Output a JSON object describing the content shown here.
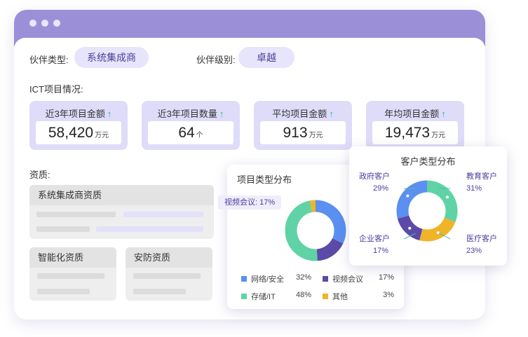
{
  "window_controls": [
    "dot",
    "dot",
    "dot"
  ],
  "partner": {
    "type_label": "伙伴类型:",
    "type_value": "系统集成商",
    "level_label": "伙伴级别:",
    "level_value": "卓越"
  },
  "ict": {
    "section_label": "ICT项目情况:",
    "cards": [
      {
        "title": "近3年项目金额",
        "value": "58,420",
        "unit": "万元",
        "icon": "arrow-up-icon"
      },
      {
        "title": "近3年项目数量",
        "value": "64",
        "unit": "个",
        "icon": "arrow-up-icon"
      },
      {
        "title": "平均项目金额",
        "value": "913",
        "unit": "万元",
        "icon": "arrow-up-icon"
      },
      {
        "title": "年均项目金额",
        "value": "19,473",
        "unit": "万元",
        "icon": "arrow-up-icon"
      }
    ]
  },
  "qualification": {
    "section_label": "资质:",
    "system_panel": "系统集成商资质",
    "smart_panel": "智能化资质",
    "security_panel": "安防资质"
  },
  "project_type_chart": {
    "tooltip": "视频会议: 17%",
    "arrow_glyph": "↑"
  },
  "chart_data": [
    {
      "type": "pie",
      "title": "项目类型分布",
      "categories": [
        "网络/安全",
        "视频会议",
        "存储/IT",
        "其他"
      ],
      "labels": [
        "32%",
        "17%",
        "48%",
        "3%"
      ],
      "values": [
        32,
        17,
        48,
        3
      ],
      "colors": [
        "#5b8ff0",
        "#5b4aa7",
        "#5fd3a5",
        "#f0b429"
      ],
      "donut": true,
      "legend": "bottom"
    },
    {
      "type": "pie",
      "title": "客户类型分布",
      "categories": [
        "政府客户",
        "教育客户",
        "医疗客户",
        "企业客户"
      ],
      "labels": [
        "29%",
        "31%",
        "23%",
        "17%"
      ],
      "values": [
        29,
        31,
        23,
        17
      ],
      "colors": [
        "#5b8ff0",
        "#5fd3a5",
        "#f0b429",
        "#5b4aa7"
      ],
      "donut": true,
      "legend": "callouts"
    }
  ]
}
